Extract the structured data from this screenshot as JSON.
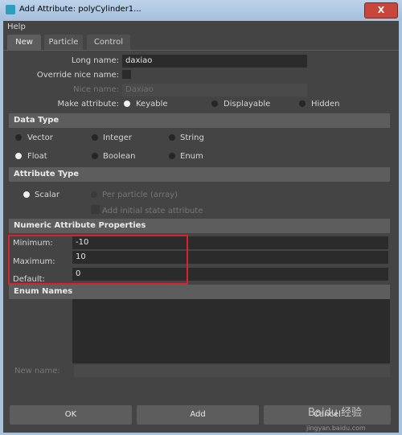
{
  "window": {
    "title": "Add Attribute: polyCylinder1...",
    "close_label": "X"
  },
  "menu": {
    "help": "Help"
  },
  "tabs": [
    "New",
    "Particle",
    "Control"
  ],
  "form": {
    "long_name_label": "Long name:",
    "long_name_value": "daxiao",
    "override_label": "Override nice name:",
    "nice_name_label": "Nice name:",
    "nice_name_value": "Daxiao",
    "make_attr_label": "Make attribute:",
    "make_attr_options": [
      "Keyable",
      "Displayable",
      "Hidden"
    ]
  },
  "data_type": {
    "header": "Data Type",
    "options": [
      "Vector",
      "Integer",
      "String",
      "Float",
      "Boolean",
      "Enum"
    ]
  },
  "attribute_type": {
    "header": "Attribute Type",
    "scalar": "Scalar",
    "per_particle": "Per particle (array)",
    "add_initial": "Add initial state attribute"
  },
  "numeric": {
    "header": "Numeric Attribute Properties",
    "minimum_label": "Minimum:",
    "minimum_value": "-10",
    "maximum_label": "Maximum:",
    "maximum_value": "10",
    "default_label": "Default:",
    "default_value": "0"
  },
  "enum": {
    "header": "Enum Names",
    "new_name_label": "New name:"
  },
  "buttons": {
    "ok": "OK",
    "add": "Add",
    "cancel": "Cancel"
  },
  "watermark": {
    "brand": "Baidu 经验",
    "url": "jingyan.baidu.com"
  },
  "colors": {
    "highlight_box": "#d8232a",
    "panel": "#444444",
    "section": "#5d5d5d"
  }
}
